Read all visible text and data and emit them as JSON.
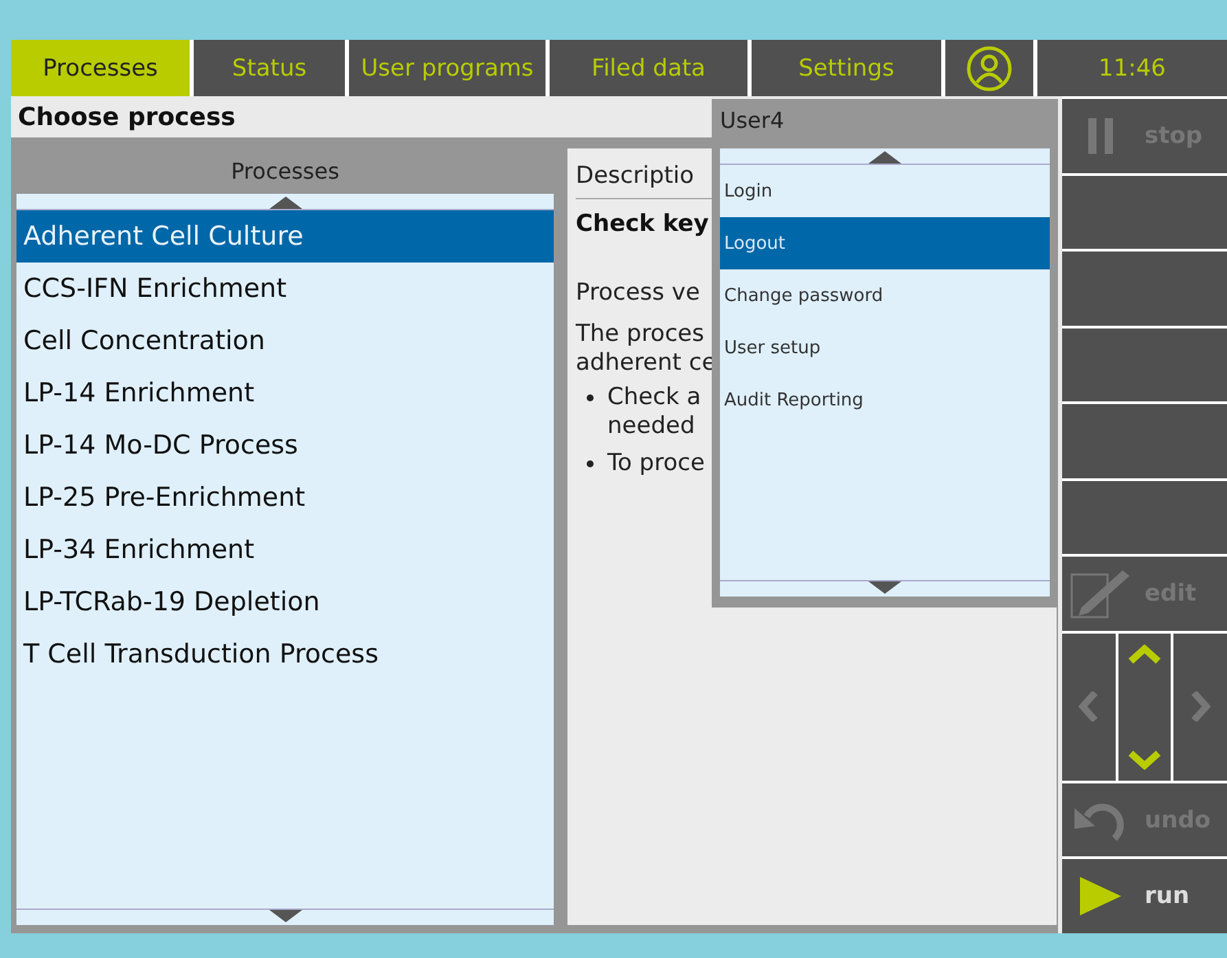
{
  "tabs": [
    {
      "label": "Processes",
      "selected": true
    },
    {
      "label": "Status",
      "selected": false
    },
    {
      "label": "User programs",
      "selected": false
    },
    {
      "label": "Filed data",
      "selected": false
    },
    {
      "label": "Settings",
      "selected": false
    }
  ],
  "clock": "11:46",
  "page_title": "Choose process",
  "process_list": {
    "header": "Processes",
    "items": [
      {
        "label": "Adherent Cell Culture",
        "selected": true
      },
      {
        "label": "CCS-IFN Enrichment",
        "selected": false
      },
      {
        "label": "Cell Concentration",
        "selected": false
      },
      {
        "label": "LP-14 Enrichment",
        "selected": false
      },
      {
        "label": "LP-14 Mo-DC Process",
        "selected": false
      },
      {
        "label": "LP-25 Pre-Enrichment",
        "selected": false
      },
      {
        "label": "LP-34 Enrichment",
        "selected": false
      },
      {
        "label": "LP-TCRab-19 Depletion",
        "selected": false
      },
      {
        "label": "T Cell Transduction Process",
        "selected": false
      }
    ]
  },
  "description": {
    "header": "Descriptio",
    "title": "Check key",
    "version": "Process ve",
    "text_lines": [
      "The proces",
      "adherent ce"
    ],
    "bullets": [
      [
        "Check a",
        "needed"
      ],
      [
        "To proce"
      ]
    ]
  },
  "user_menu": {
    "title": "User4",
    "items": [
      {
        "label": "Login",
        "selected": false
      },
      {
        "label": "Logout",
        "selected": true
      },
      {
        "label": "Change password",
        "selected": false
      },
      {
        "label": "User setup",
        "selected": false
      },
      {
        "label": "Audit Reporting",
        "selected": false
      }
    ]
  },
  "side_buttons": [
    {
      "kind": "stop",
      "label": "stop",
      "disabled": true
    },
    {
      "kind": "blank"
    },
    {
      "kind": "blank"
    },
    {
      "kind": "blank"
    },
    {
      "kind": "blank"
    },
    {
      "kind": "blank"
    },
    {
      "kind": "edit",
      "label": "edit",
      "disabled": true
    },
    {
      "kind": "nav"
    },
    {
      "kind": "undo",
      "label": "undo",
      "disabled": true
    },
    {
      "kind": "run",
      "label": "run",
      "disabled": false
    }
  ]
}
